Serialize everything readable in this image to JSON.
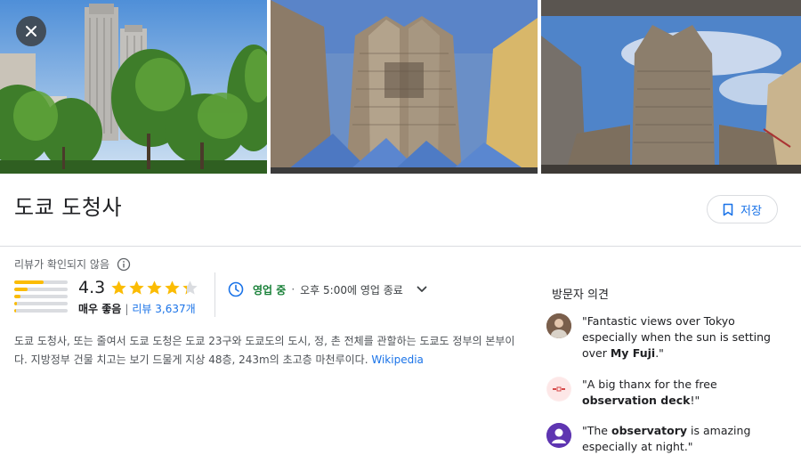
{
  "place": {
    "title": "도쿄 도청사",
    "save_label": "저장",
    "unverified_label": "리뷰가 확인되지 않음",
    "rating_score": "4.3",
    "rating_value": 4.3,
    "rating_quality": "매우 좋음",
    "reviews_label": "리뷰 3,637개",
    "rating_distribution": [
      0.55,
      0.25,
      0.12,
      0.05,
      0.03
    ],
    "hours_status": "영업 중",
    "hours_separator": "·",
    "hours_closes": "오후 5:00에 영업 종료",
    "description": "도쿄 도청사, 또는 줄여서 도쿄 도청은 도쿄 23구와 도쿄도의 도시, 정, 촌 전체를 관할하는 도쿄도 정부의 본부이다. 지방정부 건물 치고는 보기 드물게 지상 48층, 243m의 초고층 마천루이다.",
    "wiki_label": "Wikipedia"
  },
  "opinions": {
    "title": "방문자 의견",
    "items": [
      {
        "pre": "\"Fantastic views over Tokyo especially when the sun is setting over ",
        "bold": "My Fuji",
        "post": ".\"",
        "avatar": "person-photo"
      },
      {
        "pre": "\"A big thanx for the free ",
        "bold": "observation deck",
        "post": "!\"",
        "avatar": "logo-mark"
      },
      {
        "pre": "\"The ",
        "bold": "observatory",
        "post": " is amazing especially at night.\"",
        "avatar": "person-silhouette"
      }
    ]
  },
  "icons": {
    "close": "close-icon",
    "save": "bookmark-icon",
    "info": "info-icon",
    "clock": "clock-icon",
    "chevron": "chevron-down-icon"
  },
  "colors": {
    "accent": "#1a73e8",
    "open": "#188038",
    "star": "#fbbc04",
    "star_empty": "#dadce0"
  }
}
